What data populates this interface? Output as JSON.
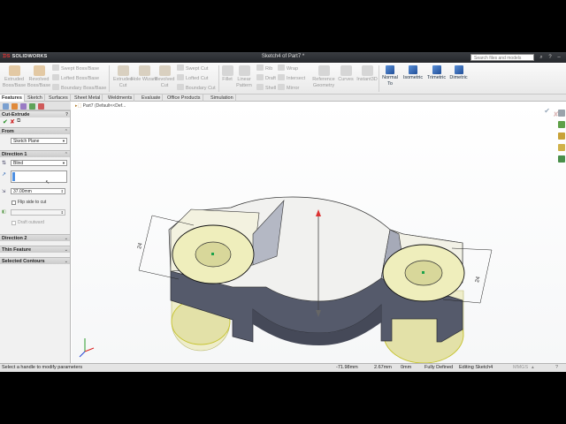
{
  "window": {
    "logo_text": "SOLIDWORKS",
    "document_title": "Sketch4 of Part7 *",
    "search_placeholder": "Search files and models"
  },
  "ribbon": {
    "big_buttons": [
      {
        "label": "Extruded Boss/Base"
      },
      {
        "label": "Revolved Boss/Base"
      },
      {
        "label": "Extruded Cut"
      },
      {
        "label": "Hole Wizard"
      },
      {
        "label": "Revolved Cut"
      },
      {
        "label": "Fillet"
      },
      {
        "label": "Linear Pattern"
      },
      {
        "label": "Reference Geometry"
      },
      {
        "label": "Curves"
      },
      {
        "label": "Instant3D"
      }
    ],
    "small_buttons": [
      {
        "label": "Swept Boss/Base"
      },
      {
        "label": "Lofted Boss/Base"
      },
      {
        "label": "Boundary Boss/Base"
      },
      {
        "label": "Swept Cut"
      },
      {
        "label": "Lofted Cut"
      },
      {
        "label": "Boundary Cut"
      },
      {
        "label": "Rib"
      },
      {
        "label": "Draft"
      },
      {
        "label": "Shell"
      },
      {
        "label": "Wrap"
      },
      {
        "label": "Intersect"
      },
      {
        "label": "Mirror"
      }
    ],
    "view_buttons": [
      {
        "label": "Normal To"
      },
      {
        "label": "Isometric"
      },
      {
        "label": "Trimetric"
      },
      {
        "label": "Dimetric"
      }
    ]
  },
  "tabs": [
    {
      "label": "Features",
      "active": true
    },
    {
      "label": "Sketch"
    },
    {
      "label": "Surfaces"
    },
    {
      "label": "Sheet Metal"
    },
    {
      "label": "Weldments"
    },
    {
      "label": "Evaluate"
    },
    {
      "label": "Office Products"
    },
    {
      "label": "Simulation"
    }
  ],
  "property_manager": {
    "title": "Cut-Extrude",
    "from_label": "From",
    "from_value": "Sketch Plane",
    "direction1_label": "Direction 1",
    "end_condition": "Blind",
    "depth_value": "37.00mm",
    "flip_side_label": "Flip side to cut",
    "draft_outward_label": "Draft outward",
    "direction2_label": "Direction 2",
    "thin_feature_label": "Thin Feature",
    "selected_contours_label": "Selected Contours"
  },
  "graphics": {
    "tree_flyout": "Part7  (Default<<Def...",
    "dimension_left": "24",
    "dimension_right": "24"
  },
  "status_bar": {
    "message": "Select a handle to modify parameters",
    "x": "-71.98mm",
    "y": "2.67mm",
    "z": "0mm",
    "state": "Fully Defined",
    "editing": "Editing Sketch4",
    "units": "MMGS"
  },
  "colors": {
    "body_face": "#575b6c",
    "highlight_face": "#f4f2c4",
    "accent": "#2a64b4"
  }
}
